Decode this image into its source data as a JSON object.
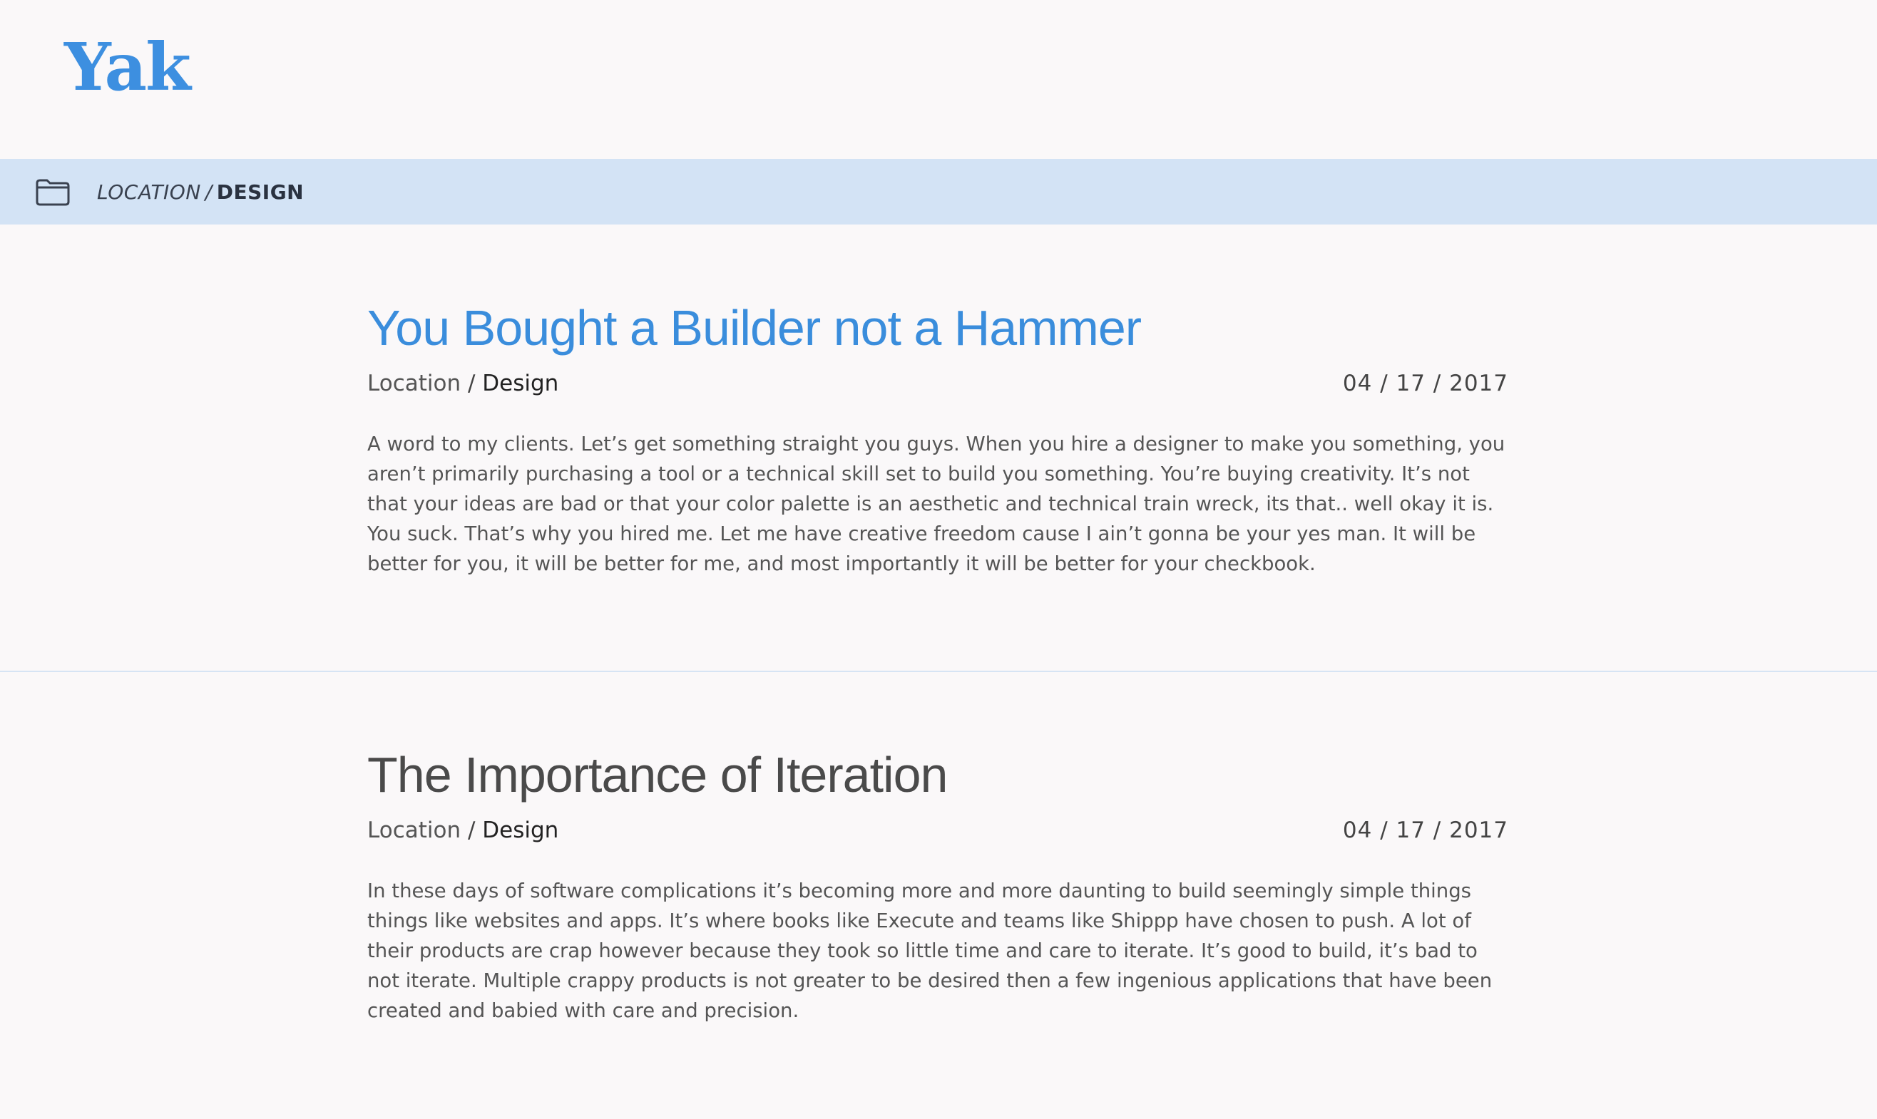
{
  "header": {
    "logo": "Yak"
  },
  "breadcrumb": {
    "icon": "folder-icon",
    "location": "LOCATION",
    "separator": "/",
    "category": "DESIGN"
  },
  "posts": [
    {
      "title": "You Bought a Builder not a Hammer",
      "location": "Location",
      "separator": "/",
      "category": "Design",
      "date": "04 / 17 / 2017",
      "excerpt": "A word to my clients. Let’s get something straight you guys. When you hire a designer to make you something, you aren’t primarily purchasing a tool or a technical skill set to build you something. You’re buying creativity. It’s not that your ideas are bad or that your color palette is an aesthetic and technical train wreck, its that.. well okay it is. You suck. That’s why you hired me. Let me have creative freedom cause I ain’t gonna be your yes man. It will be better for you, it will be better for me, and most importantly it will be better for your checkbook."
    },
    {
      "title": "The Importance of Iteration",
      "location": "Location",
      "separator": "/",
      "category": "Design",
      "date": "04 / 17 / 2017",
      "excerpt": "In these days of software complications it’s becoming more and more daunting to build seemingly simple things things like websites and apps. It’s where books like Execute and teams like Shippp have chosen to push. A lot of their products are crap however because they took so little time and care to iterate. It’s good to build, it’s bad to not iterate. Multiple crappy products is not greater to be desired then a few ingenious applications that have been created and babied with care and precision."
    }
  ],
  "colors": {
    "brand": "#3d8fe0",
    "breadcrumb_bg": "#d3e3f5",
    "page_bg": "#faf8f9"
  }
}
